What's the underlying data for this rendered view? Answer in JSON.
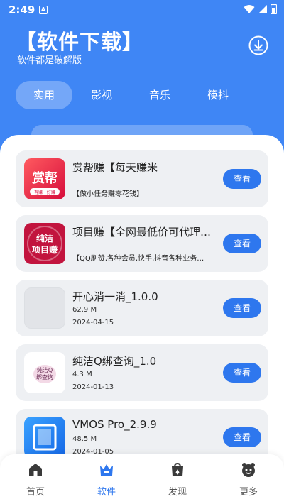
{
  "status": {
    "time": "2:49",
    "a_badge": "A"
  },
  "header": {
    "title": "【软件下载】",
    "subtitle": "软件都是破解版"
  },
  "tabs": [
    {
      "label": "实用",
      "active": true
    },
    {
      "label": "影视",
      "active": false
    },
    {
      "label": "音乐",
      "active": false
    },
    {
      "label": "筷抖",
      "active": false
    }
  ],
  "list": {
    "items": [
      {
        "name": "赏帮赚【每天赚米",
        "desc": "【做小任务赚零花钱】",
        "button": "查看",
        "thumb_text": "赏帮",
        "thumb_sub": "有赚 · 好赚"
      },
      {
        "name": "项目赚【全网最低价可代理…",
        "desc": "【QQ刷赞,各种会员,快手,抖音各种业务…",
        "button": "查看",
        "thumb_text": "纯洁项目赚"
      },
      {
        "name": "开心消一消_1.0.0",
        "size": "62.9 M",
        "date": "2024-04-15",
        "button": "查看"
      },
      {
        "name": "纯洁Q绑查询_1.0",
        "size": "4.3 M",
        "date": "2024-01-13",
        "button": "查看",
        "thumb_text": "纯洁Q绑查询"
      },
      {
        "name": "VMOS Pro_2.9.9",
        "size": "48.5 M",
        "date": "2024-01-05",
        "button": "查看"
      }
    ]
  },
  "tabbar": [
    {
      "label": "首页",
      "icon": "home-icon",
      "active": false
    },
    {
      "label": "软件",
      "icon": "crown-icon",
      "active": true
    },
    {
      "label": "发现",
      "icon": "bag-icon",
      "active": false
    },
    {
      "label": "更多",
      "icon": "more-icon",
      "active": false
    }
  ],
  "colors": {
    "primary": "#3f86f5",
    "button": "#2e77ee",
    "card": "#eef0f3"
  }
}
